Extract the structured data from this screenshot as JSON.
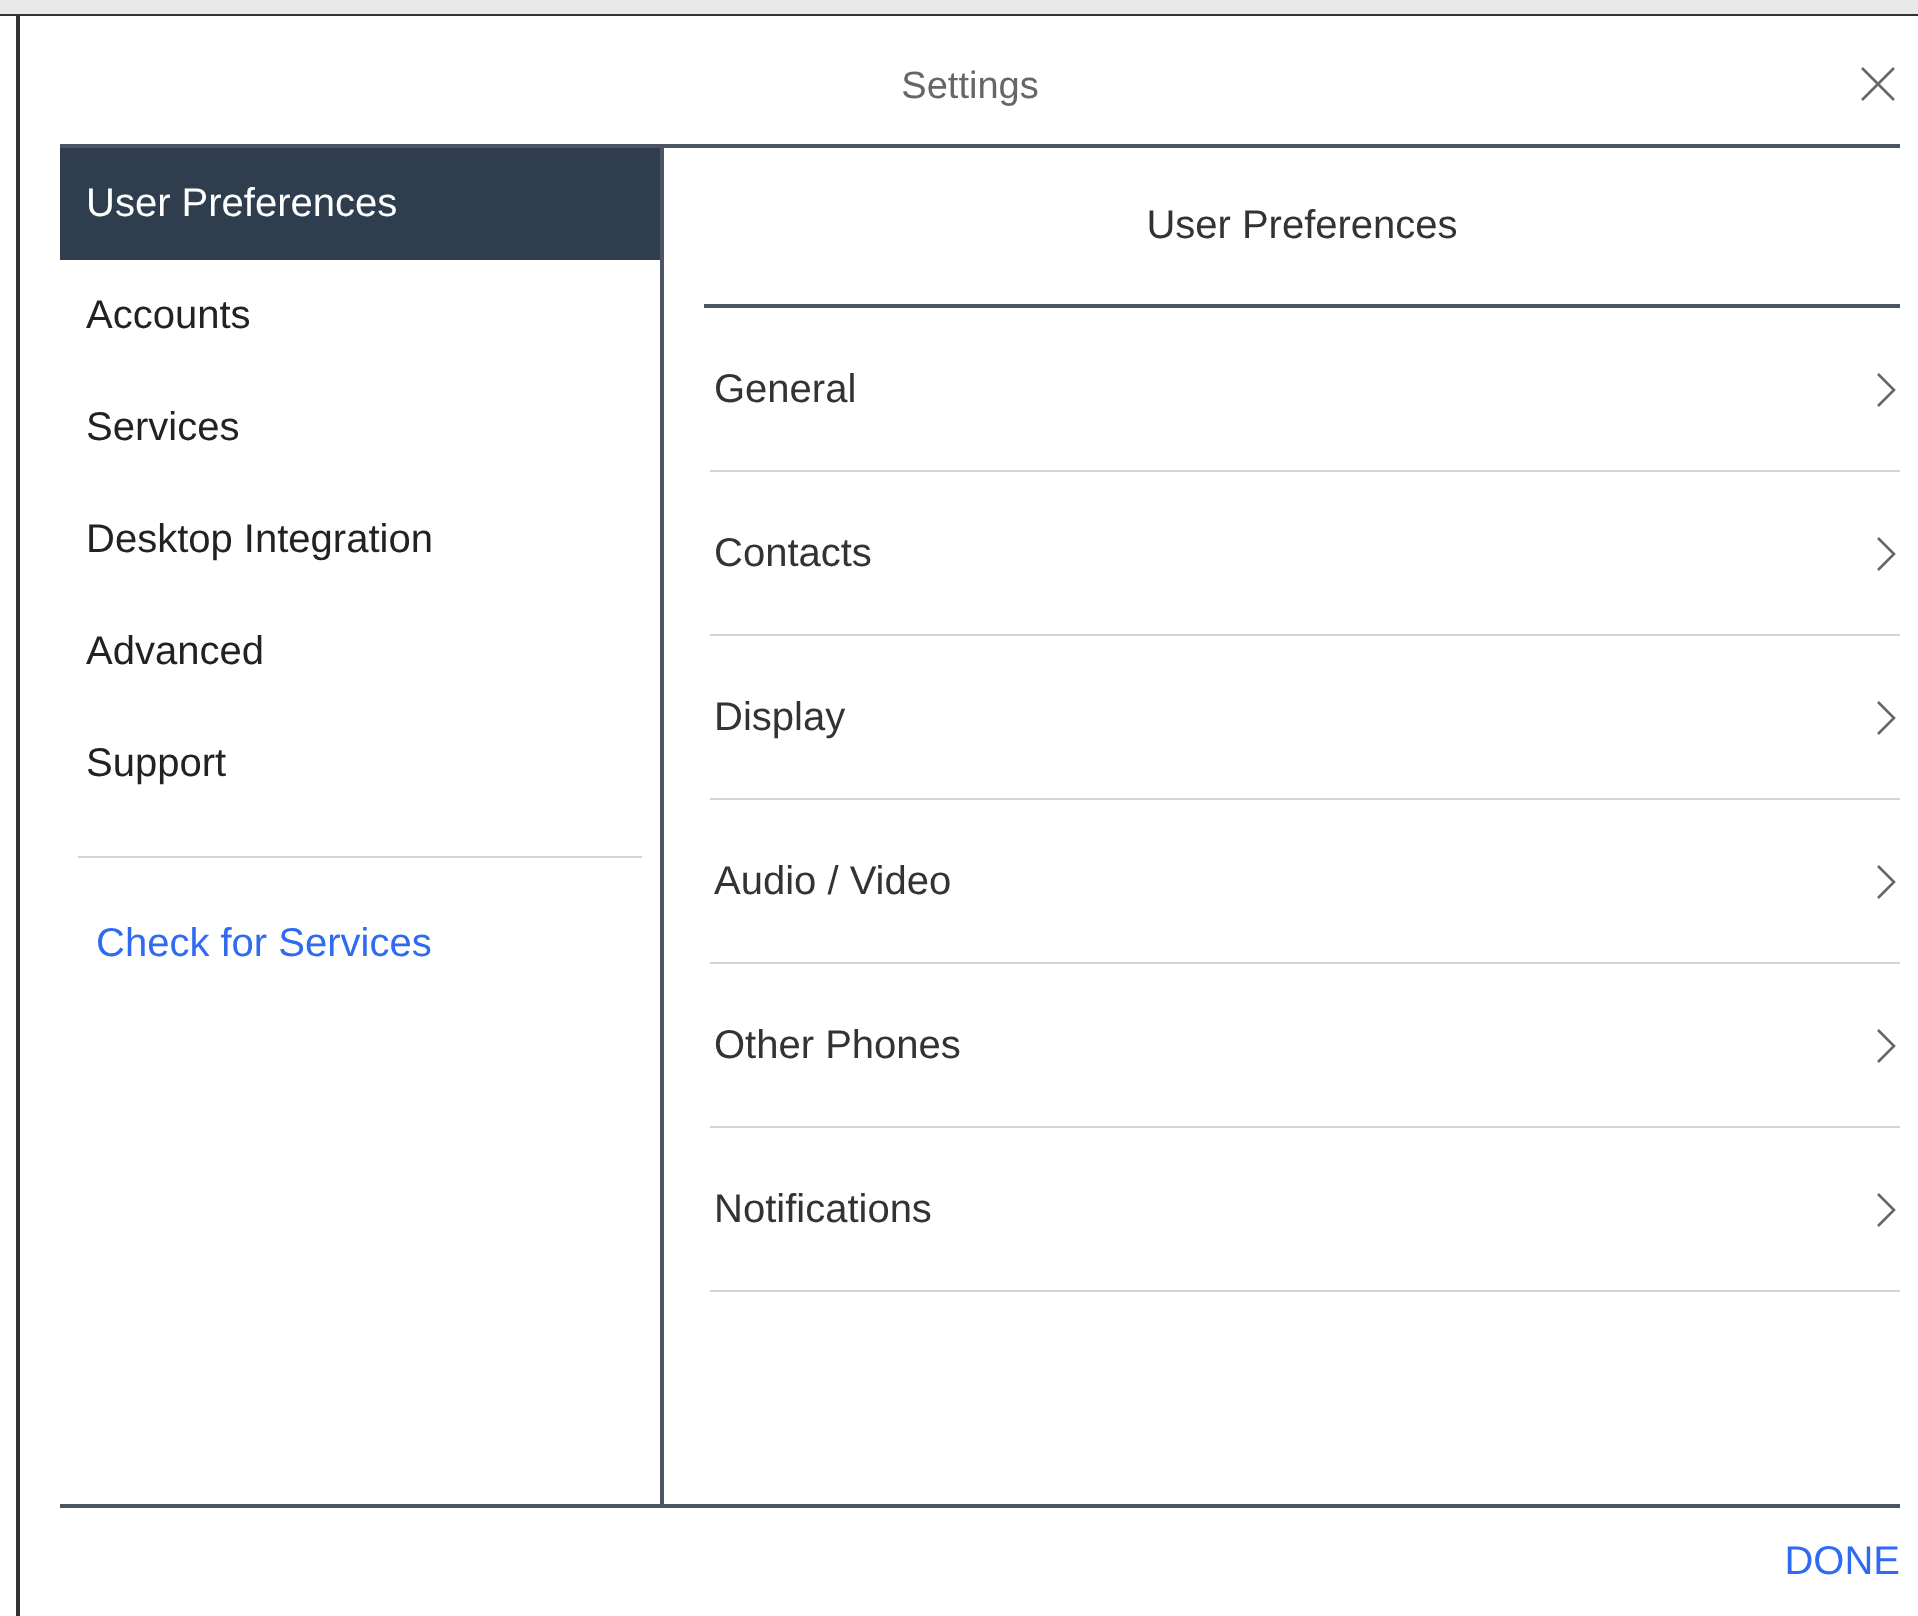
{
  "window": {
    "title": "Settings"
  },
  "sidebar": {
    "items": [
      {
        "label": "User Preferences",
        "selected": true
      },
      {
        "label": "Accounts",
        "selected": false
      },
      {
        "label": "Services",
        "selected": false
      },
      {
        "label": "Desktop Integration",
        "selected": false
      },
      {
        "label": "Advanced",
        "selected": false
      },
      {
        "label": "Support",
        "selected": false
      }
    ],
    "link": "Check for Services"
  },
  "content": {
    "heading": "User Preferences",
    "items": [
      "General",
      "Contacts",
      "Display",
      "Audio / Video",
      "Other Phones",
      "Notifications"
    ]
  },
  "footer": {
    "button": "DONE"
  }
}
